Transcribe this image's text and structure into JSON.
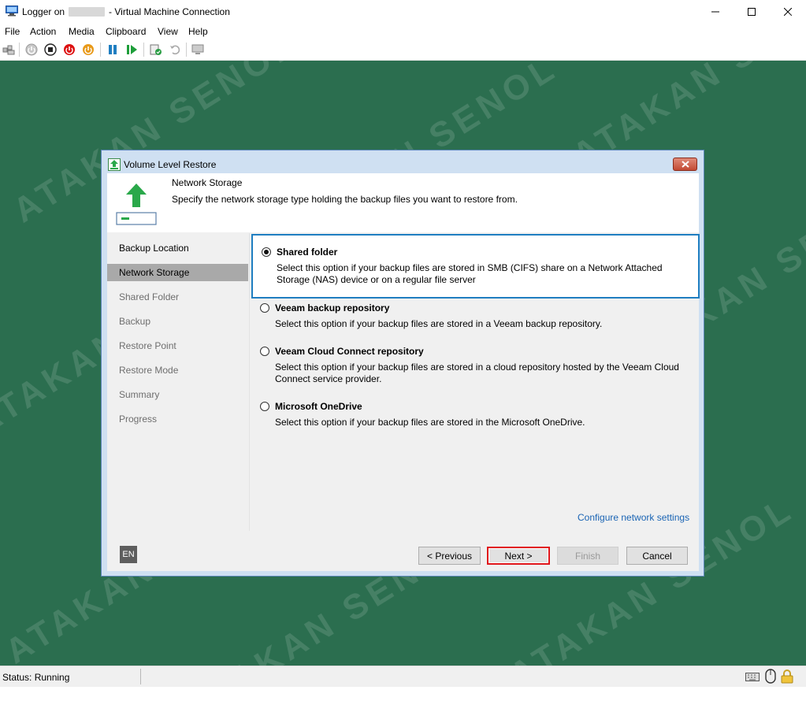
{
  "window": {
    "title_prefix": "Logger on",
    "title_suffix": "- Virtual Machine Connection"
  },
  "menu": [
    "File",
    "Action",
    "Media",
    "Clipboard",
    "View",
    "Help"
  ],
  "toolbar": {
    "icons": [
      "ctrl-alt-del-icon",
      "start-icon",
      "turn-off-icon",
      "shut-down-icon",
      "save-icon",
      "pause-icon",
      "resume-icon",
      "checkpoint-icon",
      "revert-icon",
      "enhanced-session-icon"
    ]
  },
  "dialog": {
    "title": "Volume Level Restore",
    "header": {
      "title": "Network Storage",
      "description": "Specify the network storage type holding the backup files you want to restore from."
    },
    "steps": [
      "Backup Location",
      "Network Storage",
      "Shared Folder",
      "Backup",
      "Restore Point",
      "Restore Mode",
      "Summary",
      "Progress"
    ],
    "active_step": 1,
    "options": [
      {
        "label": "Shared folder",
        "description": "Select this option if your backup files are stored in SMB (CIFS) share on a Network Attached Storage (NAS) device or on a regular file server",
        "selected": true
      },
      {
        "label": "Veeam backup repository",
        "description": "Select this option if your backup files are stored in a Veeam backup repository.",
        "selected": false
      },
      {
        "label": "Veeam Cloud Connect repository",
        "description": "Select this option if your backup files are stored in a cloud repository hosted by the Veeam Cloud Connect service provider.",
        "selected": false
      },
      {
        "label": "Microsoft OneDrive",
        "description": "Select this option if your backup files are stored in the Microsoft OneDrive.",
        "selected": false
      }
    ],
    "link": "Configure network settings",
    "lang": "EN",
    "buttons": {
      "previous": "< Previous",
      "next": "Next >",
      "finish": "Finish",
      "cancel": "Cancel"
    }
  },
  "status": {
    "text": "Status: Running"
  },
  "watermark": "ATAKAN SENOL",
  "colors": {
    "desktop": "#2b6e4f",
    "selection_border": "#1f7ec1",
    "highlight": "#e0161b",
    "link": "#1a64b4"
  }
}
